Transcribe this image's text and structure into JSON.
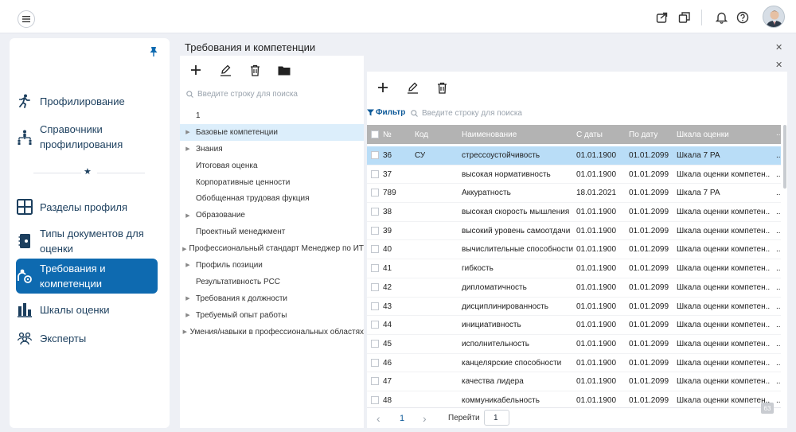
{
  "sidebar": {
    "items": [
      {
        "label": "Профилирование",
        "icon": "person-run-icon"
      },
      {
        "label": "Справочники профилирования",
        "icon": "org-people-icon"
      },
      {
        "label": "Разделы профиля",
        "icon": "grid-icon"
      },
      {
        "label": "Типы документов для оценки",
        "icon": "notebook-icon"
      },
      {
        "label": "Требования и компетенции",
        "icon": "person-gear-icon",
        "active": true
      },
      {
        "label": "Шкалы оценки",
        "icon": "bar-chart-icon"
      },
      {
        "label": "Эксперты",
        "icon": "people-icon"
      }
    ]
  },
  "page": {
    "title": "Требования и компетенции"
  },
  "tree": {
    "search_placeholder": "Введите строку для поиска",
    "items": [
      {
        "label": "1",
        "expandable": false
      },
      {
        "label": "Базовые компетенции",
        "expandable": true,
        "selected": true
      },
      {
        "label": "Знания",
        "expandable": true
      },
      {
        "label": "Итоговая оценка",
        "expandable": false
      },
      {
        "label": "Корпоративные ценности",
        "expandable": false
      },
      {
        "label": "Обобщенная трудовая фукция",
        "expandable": false
      },
      {
        "label": "Образование",
        "expandable": true
      },
      {
        "label": "Проектный менеджмент",
        "expandable": false
      },
      {
        "label": "Профессиональный стандарт Менеджер по ИТ",
        "expandable": true
      },
      {
        "label": "Профиль позиции",
        "expandable": true
      },
      {
        "label": "Результативность РСС",
        "expandable": false
      },
      {
        "label": "Требования к должности",
        "expandable": true
      },
      {
        "label": "Требуемый опыт работы",
        "expandable": true
      },
      {
        "label": "Умения/навыки в профессиональных областях",
        "expandable": true
      }
    ]
  },
  "grid": {
    "filter_label": "Фильтр",
    "search_placeholder": "Введите строку для поиска",
    "columns": [
      "№",
      "Код",
      "Наименование",
      "С даты",
      "По дату",
      "Шкала оценки"
    ],
    "more": "...",
    "rows": [
      {
        "num": "36",
        "code": "СУ",
        "name": "стрессоустойчивость",
        "from": "01.01.1900",
        "to": "01.01.2099",
        "scale": "Шкала 7 РА",
        "selected": true
      },
      {
        "num": "37",
        "code": "",
        "name": "высокая нормативность",
        "from": "01.01.1900",
        "to": "01.01.2099",
        "scale": "Шкала оценки компетен..."
      },
      {
        "num": "789",
        "code": "",
        "name": "Аккуратность",
        "from": "18.01.2021",
        "to": "01.01.2099",
        "scale": "Шкала 7 РА"
      },
      {
        "num": "38",
        "code": "",
        "name": "высокая скорость мышления",
        "from": "01.01.1900",
        "to": "01.01.2099",
        "scale": "Шкала оценки компетен..."
      },
      {
        "num": "39",
        "code": "",
        "name": "высокий уровень самоотдачи",
        "from": "01.01.1900",
        "to": "01.01.2099",
        "scale": "Шкала оценки компетен..."
      },
      {
        "num": "40",
        "code": "",
        "name": "вычислительные способности",
        "from": "01.01.1900",
        "to": "01.01.2099",
        "scale": "Шкала оценки компетен..."
      },
      {
        "num": "41",
        "code": "",
        "name": "гибкость",
        "from": "01.01.1900",
        "to": "01.01.2099",
        "scale": "Шкала оценки компетен..."
      },
      {
        "num": "42",
        "code": "",
        "name": "дипломатичность",
        "from": "01.01.1900",
        "to": "01.01.2099",
        "scale": "Шкала оценки компетен..."
      },
      {
        "num": "43",
        "code": "",
        "name": "дисциплинированность",
        "from": "01.01.1900",
        "to": "01.01.2099",
        "scale": "Шкала оценки компетен..."
      },
      {
        "num": "44",
        "code": "",
        "name": "инициативность",
        "from": "01.01.1900",
        "to": "01.01.2099",
        "scale": "Шкала оценки компетен..."
      },
      {
        "num": "45",
        "code": "",
        "name": "исполнительность",
        "from": "01.01.1900",
        "to": "01.01.2099",
        "scale": "Шкала оценки компетен..."
      },
      {
        "num": "46",
        "code": "",
        "name": "канцелярские способности",
        "from": "01.01.1900",
        "to": "01.01.2099",
        "scale": "Шкала оценки компетен..."
      },
      {
        "num": "47",
        "code": "",
        "name": "качества лидера",
        "from": "01.01.1900",
        "to": "01.01.2099",
        "scale": "Шкала оценки компетен..."
      },
      {
        "num": "48",
        "code": "",
        "name": "коммуникабельность",
        "from": "01.01.1900",
        "to": "01.01.2099",
        "scale": "Шкала оценки компетен..."
      }
    ]
  },
  "pager": {
    "prev": "‹",
    "current": "1",
    "next": "›",
    "goto_label": "Перейти",
    "goto_value": "1"
  },
  "badge": {
    "count": "63"
  },
  "colors": {
    "accent": "#0e6ab0",
    "header_gray": "#b3b3b3",
    "row_selected": "#b9ddf7",
    "tree_selected": "#dceefb"
  }
}
